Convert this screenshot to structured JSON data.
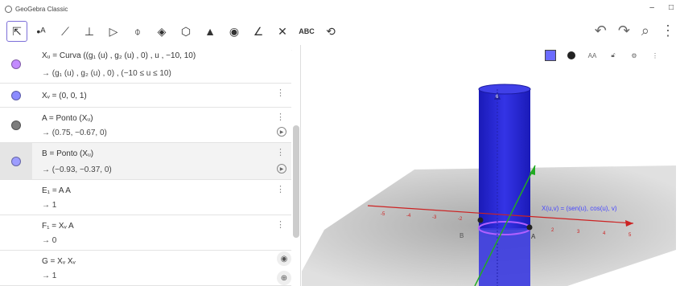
{
  "window": {
    "title": "GeoGebra Classic",
    "minimize": "–",
    "maximize": "□"
  },
  "toolbar": {
    "tools": [
      {
        "name": "move",
        "glyph": "⇱",
        "selected": true
      },
      {
        "name": "point",
        "glyph": "•ᴬ"
      },
      {
        "name": "line",
        "glyph": "⟋"
      },
      {
        "name": "perpendicular",
        "glyph": "⊥"
      },
      {
        "name": "polygon",
        "glyph": "▷"
      },
      {
        "name": "circle",
        "glyph": "⌽"
      },
      {
        "name": "intersect-surfaces",
        "glyph": "◈"
      },
      {
        "name": "plane",
        "glyph": "⬡"
      },
      {
        "name": "pyramid",
        "glyph": "▲"
      },
      {
        "name": "sphere",
        "glyph": "◉"
      },
      {
        "name": "angle",
        "glyph": "∠"
      },
      {
        "name": "reflect",
        "glyph": "✕"
      },
      {
        "name": "text",
        "glyph": "ABC"
      },
      {
        "name": "rotate-view",
        "glyph": "⟲"
      }
    ],
    "undo": "↶",
    "redo": "↷",
    "search": "⌕",
    "menu": "⋮"
  },
  "algebra": {
    "toggle_icon": "≡/",
    "rows": [
      {
        "color": "#c38bff",
        "def": "Xᵤ = Curva ((g₁ (u) , g₂ (u) , 0) , u , −10, 10)",
        "val": "→  (g₁ (u) , g₂ (u) , 0) ,    (−10 ≤ u ≤ 10)"
      },
      {
        "color": "#8b8bff",
        "def": "Xᵥ = (0, 0, 1)",
        "val": ""
      },
      {
        "color": "#7d7d7d",
        "def": "A = Ponto (Xᵤ)",
        "val": "→  (0.75, −0.67, 0)"
      },
      {
        "color": "#9d9dff",
        "def": "B = Ponto (Xᵤ)",
        "val": "→  (−0.93, −0.37, 0)"
      },
      {
        "color": "",
        "def": "E₁ = A A",
        "val": "→  1"
      },
      {
        "color": "",
        "def": "F₁ = Xᵥ A",
        "val": "→  0"
      },
      {
        "color": "",
        "def": "G = Xᵥ Xᵥ",
        "val": "→  1"
      }
    ],
    "play_icon": "▶",
    "menu_icon": "⋮"
  },
  "graphics": {
    "label_surface": "X(u,v) = (sen(u), cos(u), v)",
    "point_A": "A",
    "point_B": "B",
    "x_ticks": [
      "-5",
      "-4",
      "-3",
      "-2",
      "2",
      "3",
      "4",
      "5"
    ],
    "z_tick": "6",
    "style": {
      "color_icon": "color-swatch-icon",
      "point_style_icon": "point-style-icon",
      "text_label": "AA",
      "lock_icon": "lock-icon",
      "settings_icon": "gear-icon",
      "menu_icon": "⋮"
    }
  },
  "colors": {
    "cylinder": "#2020d0",
    "axis_x": "#cc2222",
    "axis_y": "#22aa22",
    "plane": "#999999"
  }
}
